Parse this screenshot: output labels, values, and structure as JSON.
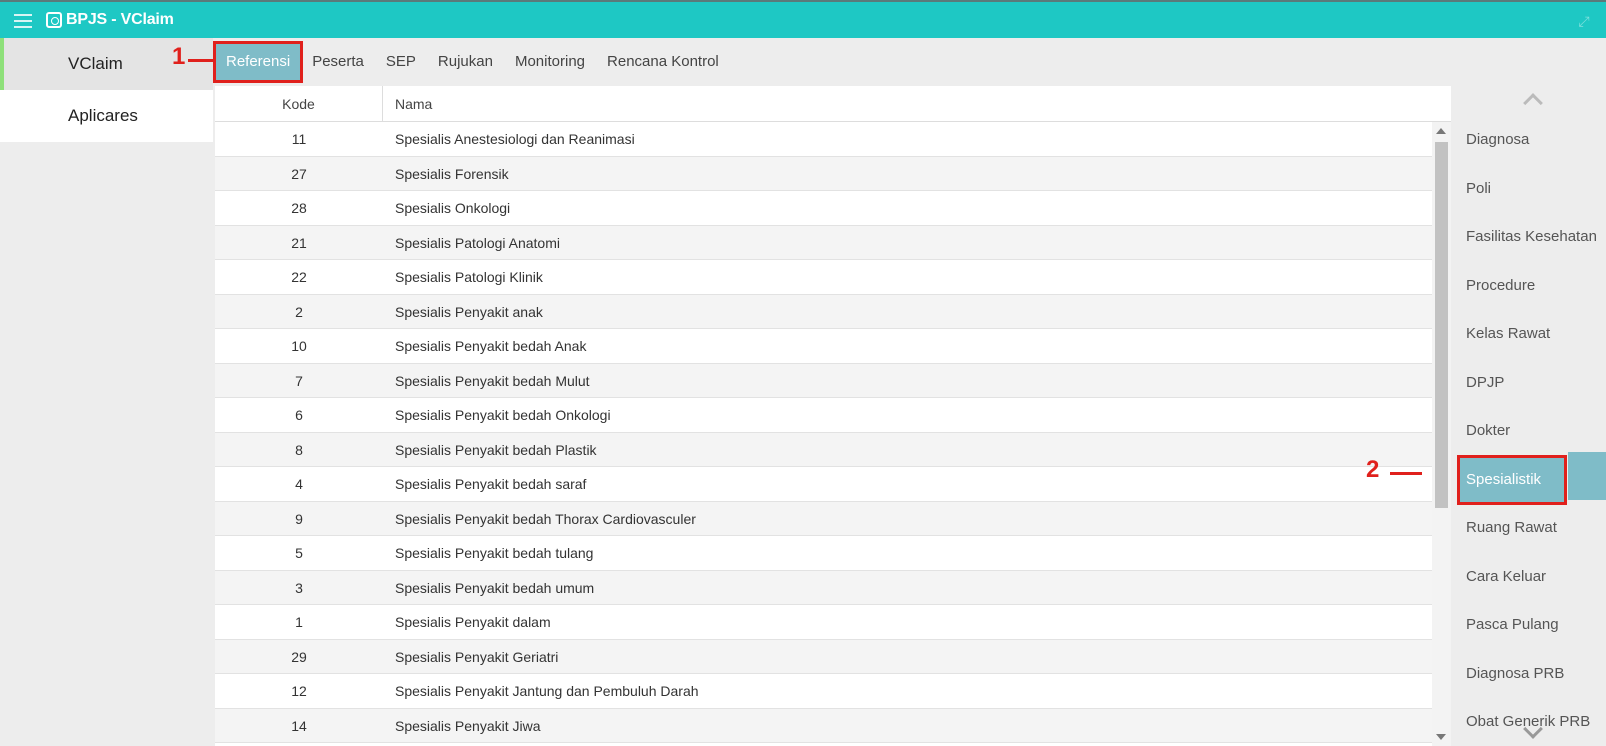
{
  "app": {
    "title": "BPJS - VClaim"
  },
  "sidebar": {
    "items": [
      {
        "label": "VClaim"
      },
      {
        "label": "Aplicares"
      }
    ]
  },
  "tabs": [
    {
      "label": "Referensi"
    },
    {
      "label": "Peserta"
    },
    {
      "label": "SEP"
    },
    {
      "label": "Rujukan"
    },
    {
      "label": "Monitoring"
    },
    {
      "label": "Rencana Kontrol"
    }
  ],
  "annotations": {
    "one": "1",
    "two": "2"
  },
  "table": {
    "headers": {
      "kode": "Kode",
      "nama": "Nama"
    },
    "rows": [
      {
        "kode": "11",
        "nama": "Spesialis Anestesiologi dan Reanimasi"
      },
      {
        "kode": "27",
        "nama": "Spesialis Forensik"
      },
      {
        "kode": "28",
        "nama": "Spesialis Onkologi"
      },
      {
        "kode": "21",
        "nama": "Spesialis Patologi Anatomi"
      },
      {
        "kode": "22",
        "nama": "Spesialis Patologi Klinik"
      },
      {
        "kode": "2",
        "nama": "Spesialis Penyakit anak"
      },
      {
        "kode": "10",
        "nama": "Spesialis Penyakit bedah Anak"
      },
      {
        "kode": "7",
        "nama": "Spesialis Penyakit bedah Mulut"
      },
      {
        "kode": "6",
        "nama": "Spesialis Penyakit bedah Onkologi"
      },
      {
        "kode": "8",
        "nama": "Spesialis Penyakit bedah Plastik"
      },
      {
        "kode": "4",
        "nama": "Spesialis Penyakit bedah saraf"
      },
      {
        "kode": "9",
        "nama": "Spesialis Penyakit bedah Thorax Cardiovasculer"
      },
      {
        "kode": "5",
        "nama": "Spesialis Penyakit bedah tulang"
      },
      {
        "kode": "3",
        "nama": "Spesialis Penyakit bedah umum"
      },
      {
        "kode": "1",
        "nama": "Spesialis Penyakit dalam"
      },
      {
        "kode": "29",
        "nama": "Spesialis Penyakit Geriatri"
      },
      {
        "kode": "12",
        "nama": "Spesialis Penyakit Jantung dan Pembuluh Darah"
      },
      {
        "kode": "14",
        "nama": "Spesialis Penyakit Jiwa"
      }
    ]
  },
  "rightmenu": {
    "items": [
      {
        "label": "Diagnosa"
      },
      {
        "label": "Poli"
      },
      {
        "label": "Fasilitas Kesehatan"
      },
      {
        "label": "Procedure"
      },
      {
        "label": "Kelas Rawat"
      },
      {
        "label": "DPJP"
      },
      {
        "label": "Dokter"
      },
      {
        "label": "Spesialistik"
      },
      {
        "label": "Ruang Rawat"
      },
      {
        "label": "Cara Keluar"
      },
      {
        "label": "Pasca Pulang"
      },
      {
        "label": "Diagnosa PRB"
      },
      {
        "label": "Obat Generik PRB"
      }
    ]
  },
  "colors": {
    "titlebar": "#1ec8c4",
    "active": "#7fbcc8",
    "highlight": "#e0201c",
    "sidebar_accent": "#8ee07a"
  }
}
